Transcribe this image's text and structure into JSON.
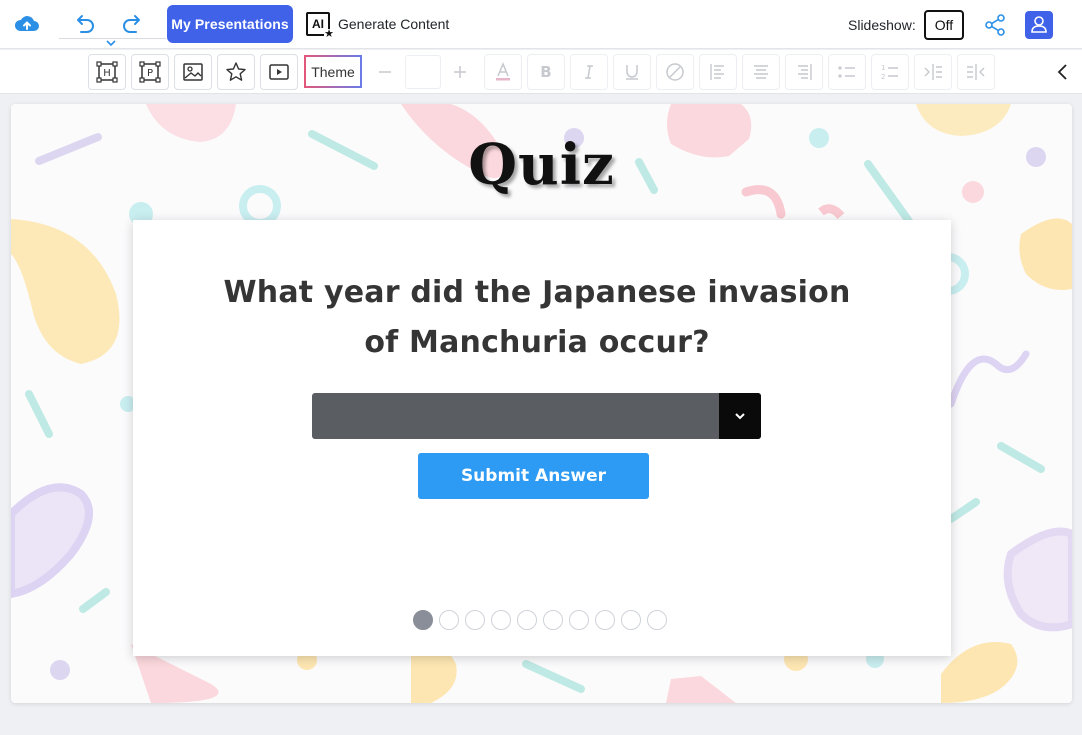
{
  "header": {
    "my_presentations_label": "My Presentations",
    "ai_badge": "AI",
    "generate_label": "Generate Content",
    "slideshow_label": "Slideshow:",
    "slideshow_state": "Off"
  },
  "toolbar": {
    "theme_label": "Theme",
    "insert_tools": [
      "heading-frame-icon",
      "paragraph-frame-icon",
      "image-icon",
      "star-icon",
      "video-icon"
    ],
    "format_tools": [
      "minus-icon",
      "plus-icon",
      "text-color-icon",
      "bold-icon",
      "italic-icon",
      "underline-icon",
      "no-style-icon",
      "align-left-icon",
      "align-center-icon",
      "align-right-icon",
      "bullet-list-icon",
      "numbered-list-icon",
      "indent-icon",
      "outdent-icon"
    ]
  },
  "slide": {
    "title": "Quiz",
    "question": "What year did the Japanese invasion of Manchuria occur?",
    "answer_select_value": "",
    "submit_label": "Submit Answer",
    "total_slides": 10,
    "current_slide": 1
  },
  "colors": {
    "accent_blue": "#3f62e9",
    "submit_blue": "#2d9af3",
    "select_gray": "#5a5e63"
  }
}
